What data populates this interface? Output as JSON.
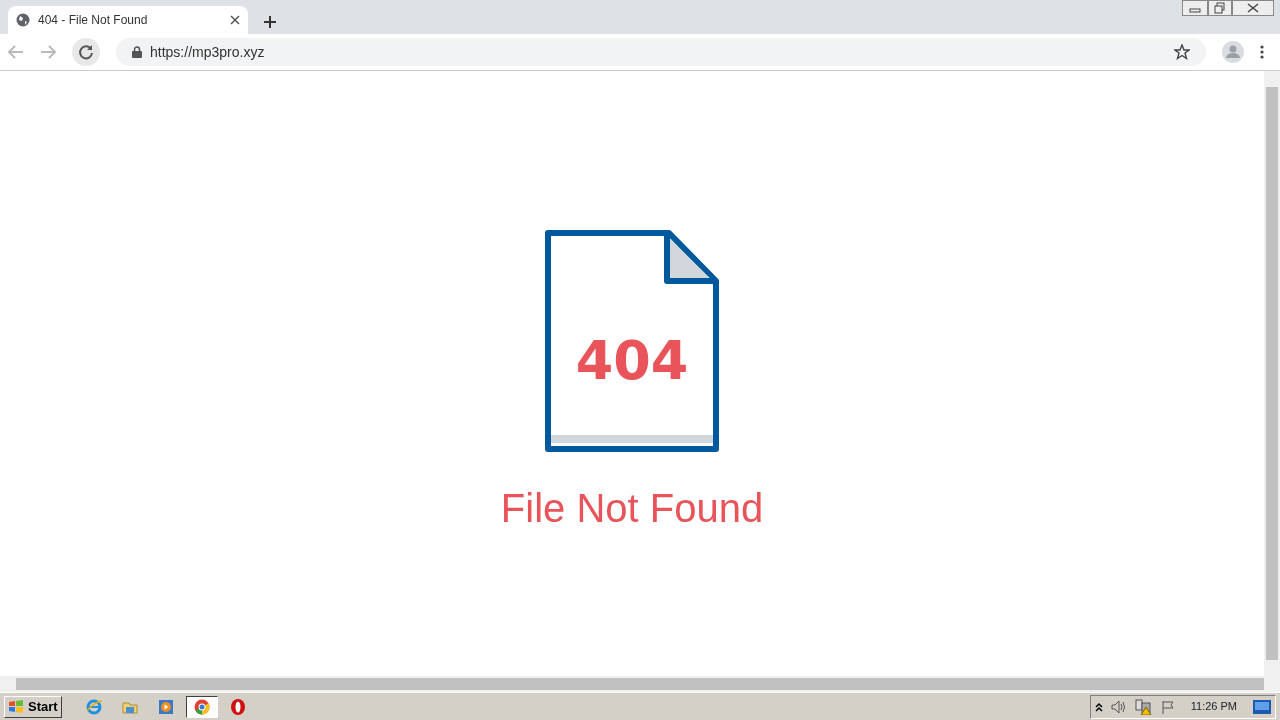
{
  "browser": {
    "tab": {
      "title": "404 - File Not Found",
      "selected": true
    },
    "url": "https://mp3pro.xyz"
  },
  "page": {
    "code": "404",
    "message": "File Not Found"
  },
  "taskbar": {
    "start": "Start",
    "apps": [
      {
        "kind": "browser",
        "selected": false
      },
      {
        "kind": "folder",
        "selected": false
      },
      {
        "kind": "media",
        "selected": false
      },
      {
        "kind": "chrome",
        "selected": true
      },
      {
        "kind": "opera",
        "selected": false
      }
    ],
    "clock": "11:26 PM"
  }
}
